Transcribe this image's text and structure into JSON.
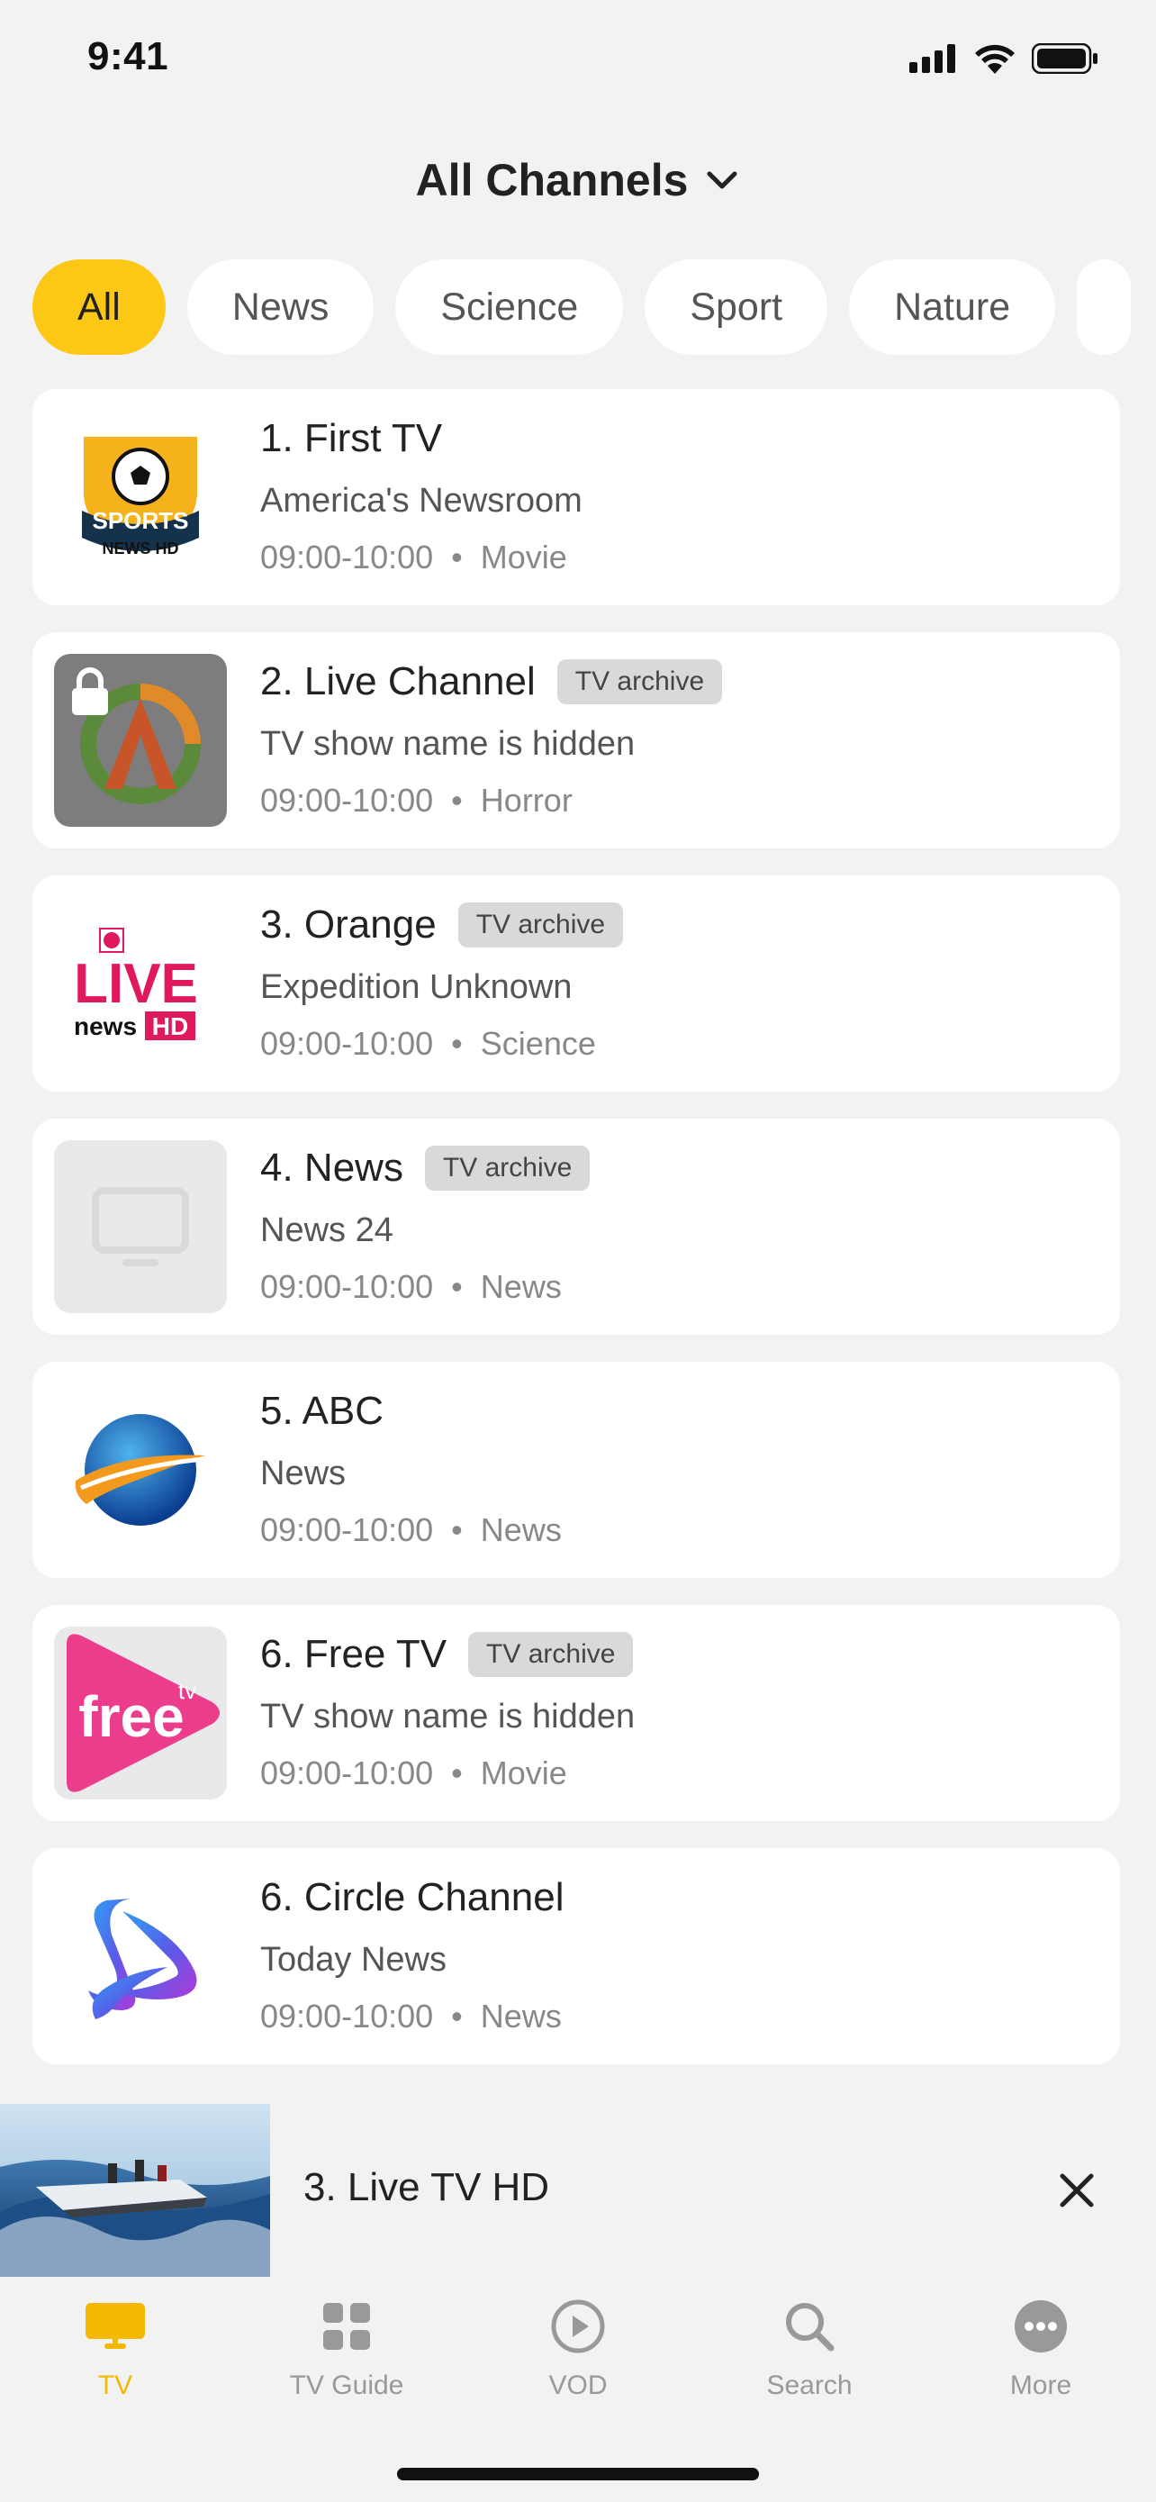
{
  "status_bar": {
    "time": "9:41"
  },
  "header": {
    "title": "All Channels"
  },
  "filters": [
    "All",
    "News",
    "Science",
    "Sport",
    "Nature"
  ],
  "channels": [
    {
      "title": "1. First TV",
      "badge": "",
      "show": "America's Newsroom",
      "time": "09:00-10:00",
      "genre": "Movie",
      "logo": "sports-news-hd-logo",
      "logo_text": [
        "SPORTS",
        "NEWS HD"
      ]
    },
    {
      "title": "2. Live Channel",
      "badge": "TV archive",
      "show": "TV show name is hidden",
      "time": "09:00-10:00",
      "genre": "Horror",
      "logo": "locked-channel-logo"
    },
    {
      "title": "3. Orange",
      "badge": "TV archive",
      "show": "Expedition Unknown",
      "time": "09:00-10:00",
      "genre": "Science",
      "logo": "live-news-hd-logo",
      "logo_text": [
        "LIVE",
        "news",
        "HD"
      ]
    },
    {
      "title": "4. News",
      "badge": "TV archive",
      "show": "News 24",
      "time": "09:00-10:00",
      "genre": "News",
      "logo": "tv-placeholder-icon"
    },
    {
      "title": "5. ABC",
      "badge": "",
      "show": "News",
      "time": "09:00-10:00",
      "genre": "News",
      "logo": "globe-logo"
    },
    {
      "title": "6. Free TV",
      "badge": "TV archive",
      "show": "TV show name is hidden",
      "time": "09:00-10:00",
      "genre": "Movie",
      "logo": "free-tv-logo",
      "logo_text": [
        "free",
        "tv"
      ]
    },
    {
      "title": "6. Circle Channel",
      "badge": "",
      "show": "Today News",
      "time": "09:00-10:00",
      "genre": "News",
      "logo": "circle-channel-logo"
    }
  ],
  "mini_player": {
    "title": "3. Live TV HD"
  },
  "tabs": [
    "TV",
    "TV Guide",
    "VOD",
    "Search",
    "More"
  ],
  "colors": {
    "accent": "#fdc716",
    "tab_active": "#f5b800",
    "background": "#f2f2f2"
  }
}
